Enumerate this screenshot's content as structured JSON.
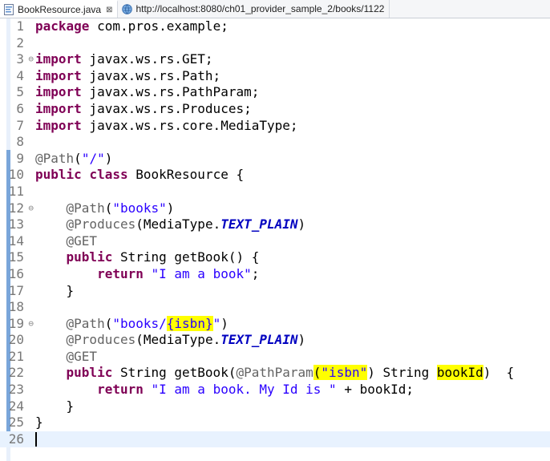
{
  "tabs": [
    {
      "label": "BookResource.java",
      "close": "⊠",
      "icon": "java-file-icon",
      "active": true
    },
    {
      "label": "http://localhost:8080/ch01_provider_sample_2/books/1122",
      "icon": "globe-icon",
      "active": false
    }
  ],
  "code": {
    "line_numbers": [
      "1",
      "2",
      "3",
      "4",
      "5",
      "6",
      "7",
      "8",
      "9",
      "10",
      "11",
      "12",
      "13",
      "14",
      "15",
      "16",
      "17",
      "18",
      "19",
      "20",
      "21",
      "22",
      "23",
      "24",
      "25",
      "26"
    ],
    "tokens": {
      "package_kw": "package",
      "package_name": " com.pros.example;",
      "import_kw": "import",
      "import1": " javax.ws.rs.GET;",
      "import2": " javax.ws.rs.Path;",
      "import3": " javax.ws.rs.PathParam;",
      "import4": " javax.ws.rs.Produces;",
      "import5": " javax.ws.rs.core.MediaType;",
      "path_ann": "@Path",
      "produces_ann": "@Produces",
      "get_ann": "@GET",
      "pathparam_ann": "@PathParam",
      "open_paren": "(",
      "close_paren": ")",
      "root_path": "\"/\"",
      "public_kw": "public",
      "class_kw": "class",
      "class_name": " BookResource {",
      "books_path": "\"books\"",
      "media_type": "MediaType.",
      "text_plain": "TEXT_PLAIN",
      "string_get_book": " String getBook() {",
      "return_kw": "return",
      "book_string": "\"I am a book\"",
      "semicolon": ";",
      "close_brace": "}",
      "books_isbn_prefix": "\"books/",
      "isbn_placeholder": "{isbn}",
      "quote_close": "\"",
      "string_get_book_param": " String getBook(",
      "isbn_string": "\"isbn\"",
      "string_type": " String ",
      "book_id": "bookId",
      "method_tail": ")  {",
      "id_string": "\"I am a book. My Id is \"",
      "concat_book_id": " + bookId;"
    }
  }
}
